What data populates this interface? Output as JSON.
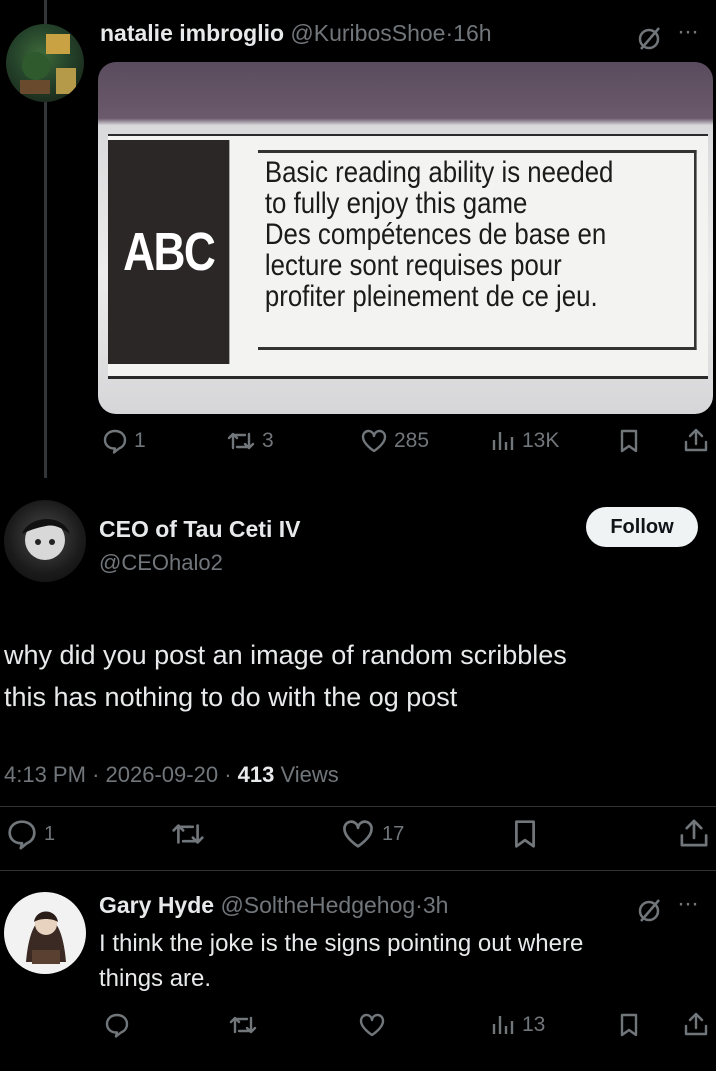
{
  "tweet1": {
    "display_name": "natalie imbroglio",
    "handle": "@KuribosShoe",
    "time": "16h",
    "image": {
      "badge": "ABC",
      "lines": [
        "Basic reading ability is needed",
        "to fully enjoy this game",
        "Des compétences de base en",
        "lecture sont requises pour",
        "profiter pleinement de ce jeu."
      ]
    },
    "actions": {
      "replies": "1",
      "reposts": "3",
      "likes": "285",
      "views": "13K"
    }
  },
  "reply": {
    "display_name": "CEO of Tau Ceti IV",
    "handle": "@CEOhalo2",
    "follow_label": "Follow",
    "text_line1": "why did you post an image of random scribbles",
    "text_line2": "this has nothing to do with the og post",
    "time": "4:13 PM",
    "date": "2026-09-20",
    "views_count": "413",
    "views_label": "Views",
    "actions": {
      "replies": "1",
      "likes": "17"
    }
  },
  "tweet3": {
    "display_name": "Gary Hyde",
    "handle": "@SoltheHedgehog",
    "time": "3h",
    "text_line1": "I think the joke is the signs pointing out where",
    "text_line2": "things are.",
    "actions": {
      "views": "13"
    }
  },
  "separator": "·",
  "more": "···",
  "colors": {
    "background": "#000000",
    "text": "#e7e9ea",
    "muted": "#71767b",
    "divider": "#2f3336"
  }
}
